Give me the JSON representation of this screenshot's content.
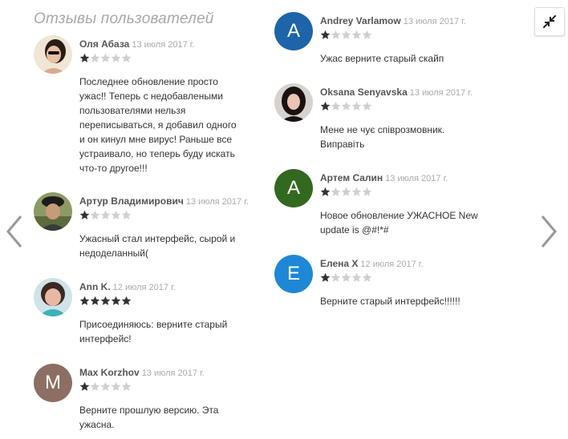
{
  "page": {
    "title": "Отзывы пользователей"
  },
  "colors": {
    "star_filled": "#333333",
    "star_empty": "#d0d0d0",
    "text": "#333333",
    "meta": "#aaaaaa"
  },
  "icons": {
    "collapse": "collapse-icon",
    "prev": "chevron-left-icon",
    "next": "chevron-right-icon",
    "star": "star-icon"
  },
  "reviews_left": [
    {
      "author": "Оля Абаза",
      "date": "13 июля 2017 г.",
      "rating": 1,
      "avatar_letter": "",
      "text": "Последнее обновление просто ужас!! Теперь с недобавлеными пользователями нельзя переписываться, я добавил одного и он кинул мне вирус! Раньше все устраивало, но теперь буду искать что-то другое!!!"
    },
    {
      "author": "Артур Владимирович",
      "date": "13 июля 2017 г.",
      "rating": 1,
      "avatar_letter": "",
      "text": "Ужасный стал интерфейс, сырой и недоделанный("
    },
    {
      "author": "Ann K.",
      "date": "12 июля 2017 г.",
      "rating": 5,
      "avatar_letter": "",
      "text": "Присоединяюсь: верните старый интерфейс!"
    },
    {
      "author": "Max Korzhov",
      "date": "13 июля 2017 г.",
      "rating": 1,
      "avatar_letter": "M",
      "text": "Верните прошлую версию. Эта ужасна."
    }
  ],
  "reviews_right": [
    {
      "author": "Andrey Varlamow",
      "date": "13 июля 2017 г.",
      "rating": 1,
      "avatar_letter": "A",
      "text": "Ужас верните старый скайп"
    },
    {
      "author": "Oksana Senyavska",
      "date": "13 июля 2017 г.",
      "rating": 1,
      "avatar_letter": "",
      "text": "Мене не чує співрозмовник. Виправіть"
    },
    {
      "author": "Артем Салин",
      "date": "13 июля 2017 г.",
      "rating": 1,
      "avatar_letter": "A",
      "text": "Новое обновление УЖАСНОЕ New update is @#!*#"
    },
    {
      "author": "Елена Х",
      "date": "12 июля 2017 г.",
      "rating": 1,
      "avatar_letter": "E",
      "text": "Верните старый интерфейс!!!!!!"
    }
  ]
}
